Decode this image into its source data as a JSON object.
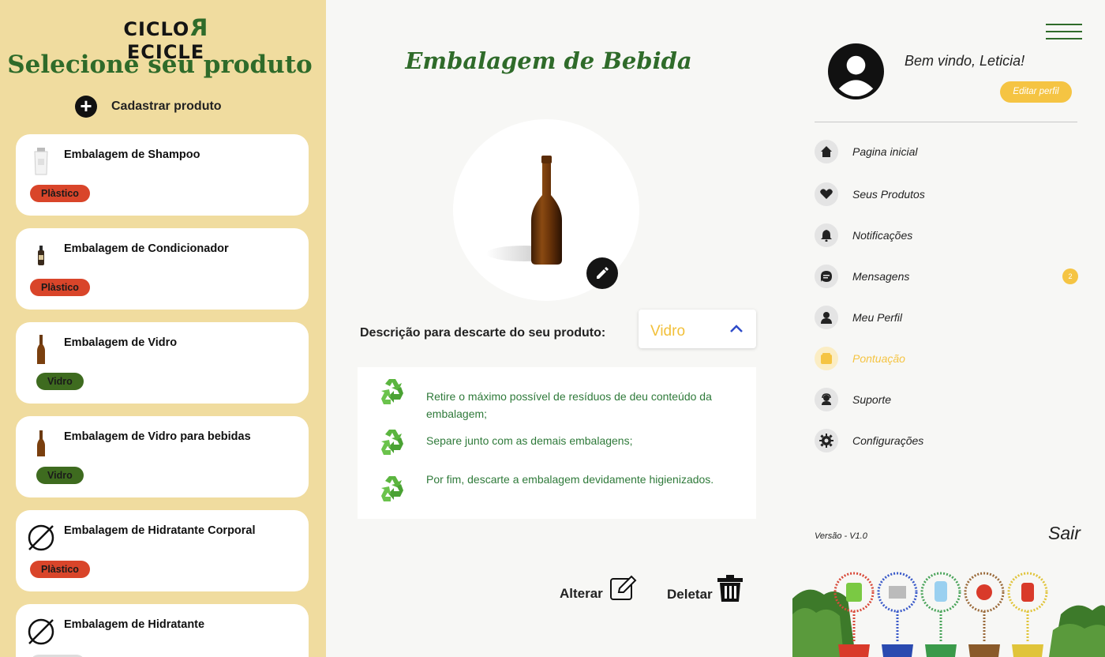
{
  "sidebar": {
    "logo": {
      "left": "CICLO",
      "flipped": "R",
      "right": "ECICLE"
    },
    "title": "Selecione seu produto",
    "add_label": "Cadastrar produto",
    "products": [
      {
        "name": "Embalagem de Shampoo",
        "tag": "Plàstico",
        "thumb": "shampoo-bottle-image"
      },
      {
        "name": "Embalagem de Condicionador",
        "tag": "Plàstico",
        "thumb": "conditioner-bottle-image"
      },
      {
        "name": "Embalagem de Vidro",
        "tag": "Vidro",
        "thumb": "glass-bottle-image"
      },
      {
        "name": "Embalagem de Vidro para bebidas",
        "tag": "Vidro",
        "thumb": "glass-bottle-image"
      },
      {
        "name": "Embalagem de Hidratante Corporal",
        "tag": "Plàstico",
        "thumb": "no-image-icon"
      },
      {
        "name": "Embalagem de Hidratante",
        "tag": "",
        "thumb": "no-image-icon"
      }
    ]
  },
  "main": {
    "title": "Embalagem de Bebida",
    "description_label": "Descrição para descarte do seu produto:",
    "material_select": {
      "value": "Vidro"
    },
    "steps": [
      {
        "text": "Retire o máximo possível de resíduos de deu conteúdo da embalagem;"
      },
      {
        "text": "Separe junto com as demais embalagens;"
      },
      {
        "text": "Por fim, descarte a embalagem devidamente higienizados."
      }
    ],
    "alter_label": "Alterar",
    "delete_label": "Deletar"
  },
  "profile": {
    "welcome": "Bem vindo, Leticia!",
    "edit_label": "Editar perfil"
  },
  "nav": [
    {
      "label": "Pagina inicial",
      "icon": "home-icon"
    },
    {
      "label": "Seus Produtos",
      "icon": "heart-hand-icon"
    },
    {
      "label": "Notificações",
      "icon": "bell-icon"
    },
    {
      "label": "Mensagens",
      "icon": "chat-icon",
      "badge": "2"
    },
    {
      "label": "Meu Perfil",
      "icon": "user-icon"
    },
    {
      "label": "Pontuação",
      "icon": "wallet-icon",
      "active": true
    },
    {
      "label": "Suporte",
      "icon": "support-icon"
    },
    {
      "label": "Configurações",
      "icon": "gear-icon"
    }
  ],
  "footer": {
    "version": "Versão - V1.0",
    "logout": "Sair"
  },
  "colors": {
    "sidebar_bg": "#f0dc9f",
    "brand_green": "#2f6b2a",
    "accent_yellow": "#f5c443",
    "plastic_tag": "#d9452a",
    "glass_tag": "#3e6b1f",
    "step_text": "#2f7a3a"
  }
}
